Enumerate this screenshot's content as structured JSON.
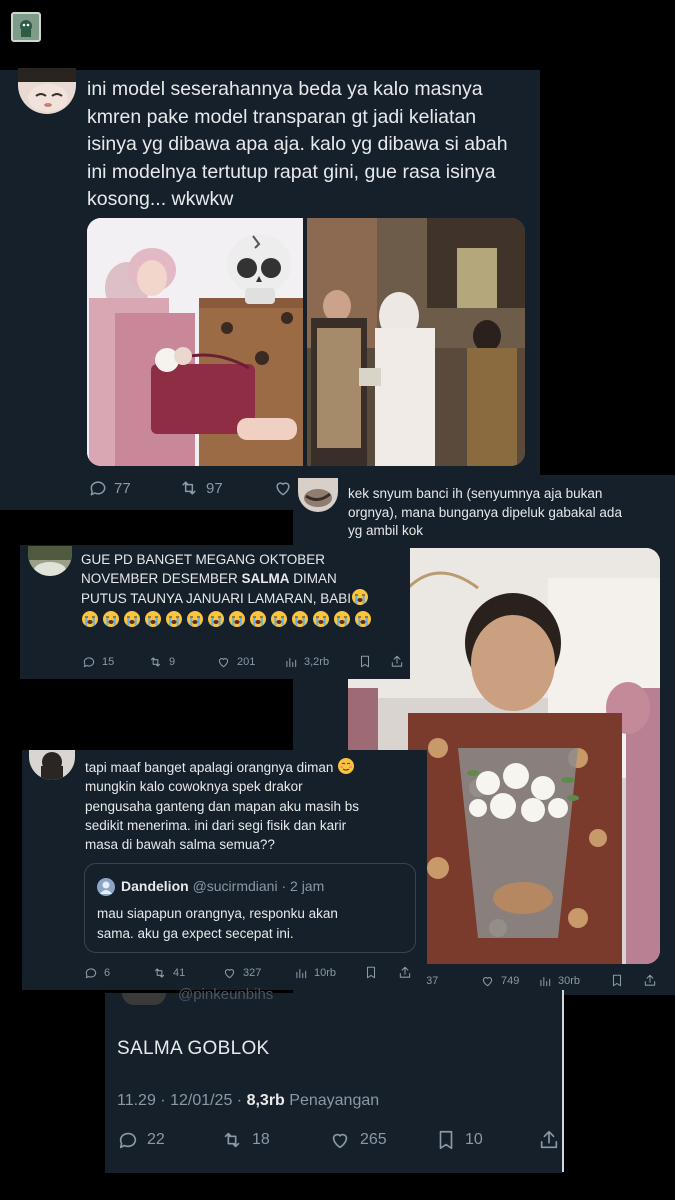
{
  "tweet1": {
    "text_lines": [
      "ini model seserahannya beda ya kalo masnya",
      "kmren pake model transparan gt jadi keliatan",
      "isinya yg dibawa apa aja. kalo yg dibawa si abah",
      "ini modelnya tertutup rapat gini, gue rasa isinya",
      "kosong... wkwkw"
    ],
    "reply_count": "77",
    "retweet_count": "97"
  },
  "tweet_ssnyum": {
    "text_lines": [
      "kek snyum banci ih (senyumnya aja bukan",
      "orgnya), mana bunganya dipeluk gabakal ada",
      "yg ambil kok"
    ],
    "reply_partial": "37",
    "likes": "749",
    "views": "30rb"
  },
  "tweet_gue": {
    "line1": "GUE PD BANGET MEGANG OKTOBER",
    "line2_a": "NOVEMBER DESEMBER ",
    "line2_b": "SALMA",
    "line2_c": " DIMAN",
    "line3": "PUTUS TAUNYA JANUARI LAMARAN, BABI",
    "emoji_count": 15,
    "replies": "15",
    "retweets": "9",
    "likes": "201",
    "views": "3,2rb"
  },
  "tweet_tapi": {
    "text_lines": [
      "tapi maaf banget apalagi orangnya diman",
      "mungkin kalo cowoknya spek drakor",
      "pengusaha ganteng dan mapan aku masih bs",
      "sedikit menerima. ini dari segi fisik dan karir",
      "masa di bawah salma semua??"
    ],
    "quote": {
      "name": "Dandelion",
      "handle": "@sucirmdiani",
      "time": "· 2 jam",
      "text_lines": [
        "mau siapapun orangnya, responku akan",
        "sama. aku ga expect secepat ini."
      ]
    },
    "replies": "6",
    "retweets": "41",
    "likes": "327",
    "views": "10rb"
  },
  "tweet_main": {
    "handle_partial": "@pinkeunbihs",
    "text": "SALMA GOBLOK",
    "time": "11.29 · 12/01/25 · ",
    "views_count": "8,3rb",
    "views_label": " Penayangan",
    "replies": "22",
    "retweets": "18",
    "likes": "265",
    "bookmarks": "10"
  },
  "colors": {
    "bg": "#000000",
    "card": "#15202b",
    "text": "#e7e9ea",
    "muted": "#8b98a5"
  }
}
